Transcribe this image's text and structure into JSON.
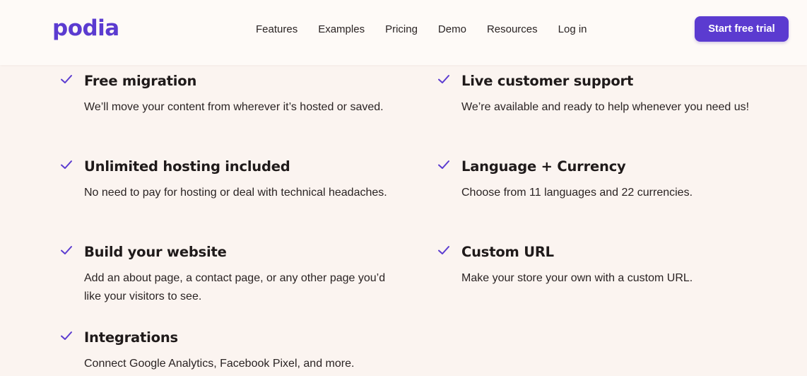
{
  "brand": {
    "logo_text": "podia",
    "accent_color": "#5b3bd0"
  },
  "nav": {
    "items": [
      "Features",
      "Examples",
      "Pricing",
      "Demo",
      "Resources",
      "Log in"
    ]
  },
  "header": {
    "cta_label": "Start free trial"
  },
  "features": [
    {
      "title": "Free migration",
      "description": "We’ll move your content from wherever it’s hosted or saved."
    },
    {
      "title": "Live customer support",
      "description": "We’re available and ready to help whenever you need us!"
    },
    {
      "title": "Unlimited hosting included",
      "description": "No need to pay for hosting or deal with technical headaches."
    },
    {
      "title": "Language + Currency",
      "description": "Choose from 11 languages and 22 currencies."
    },
    {
      "title": "Build your website",
      "description": "Add an about page, a contact page, or any other page you’d like your visitors to see."
    },
    {
      "title": "Custom URL",
      "description": "Make your store your own with a custom URL."
    },
    {
      "title": "Integrations",
      "description": "Connect Google Analytics, Facebook Pixel, and more."
    }
  ],
  "icons": {
    "feature_check": "check-icon"
  }
}
